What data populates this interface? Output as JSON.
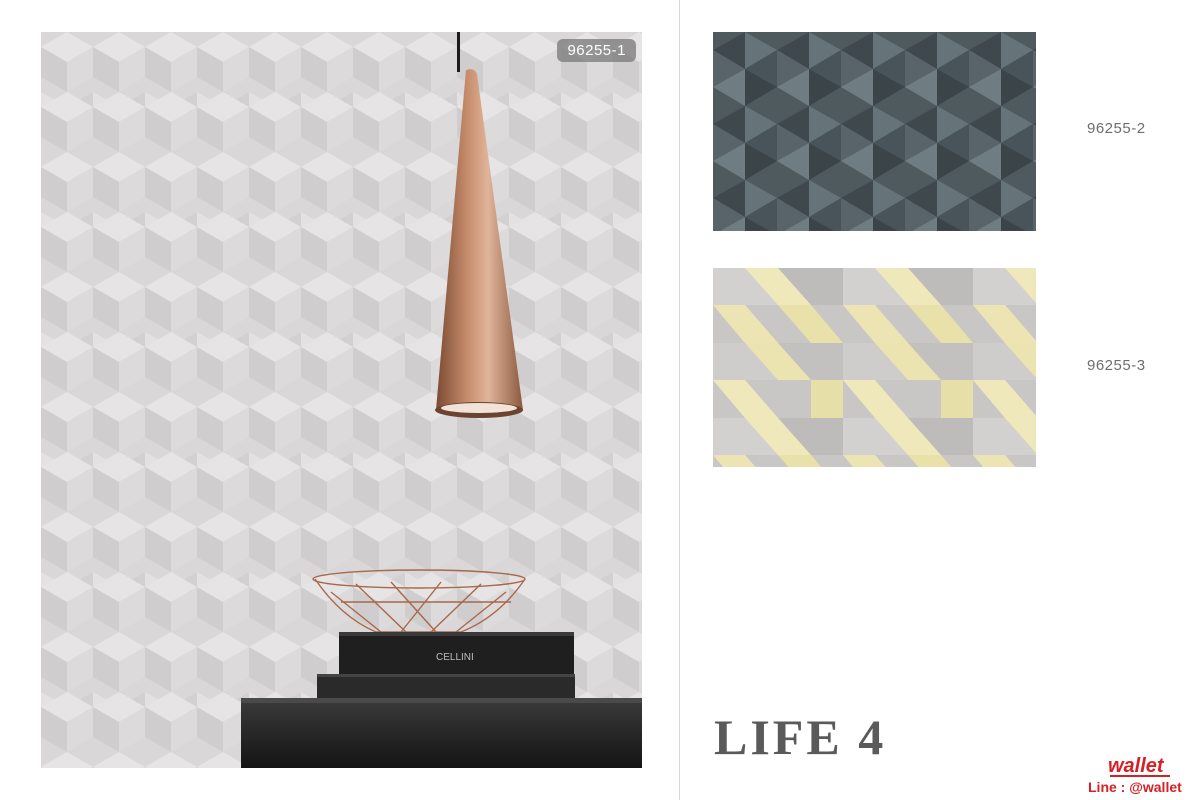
{
  "hero": {
    "product_code": "96255-1",
    "wall_color": "#d8d6d7",
    "lamp_color": "#b87a5c"
  },
  "swatches": [
    {
      "code": "96255-2",
      "base_color": "#4f5a5f",
      "pattern": "3d-triangles"
    },
    {
      "code": "96255-3",
      "base_color": "#c9c7c6",
      "accent_color": "#ece5b3",
      "pattern": "3d-cubes"
    }
  ],
  "collection": {
    "title": "LIFE 4"
  },
  "brand": {
    "logo_text": "wallet",
    "line_text": "Line : @wallet",
    "accent_color": "#d71f26"
  }
}
